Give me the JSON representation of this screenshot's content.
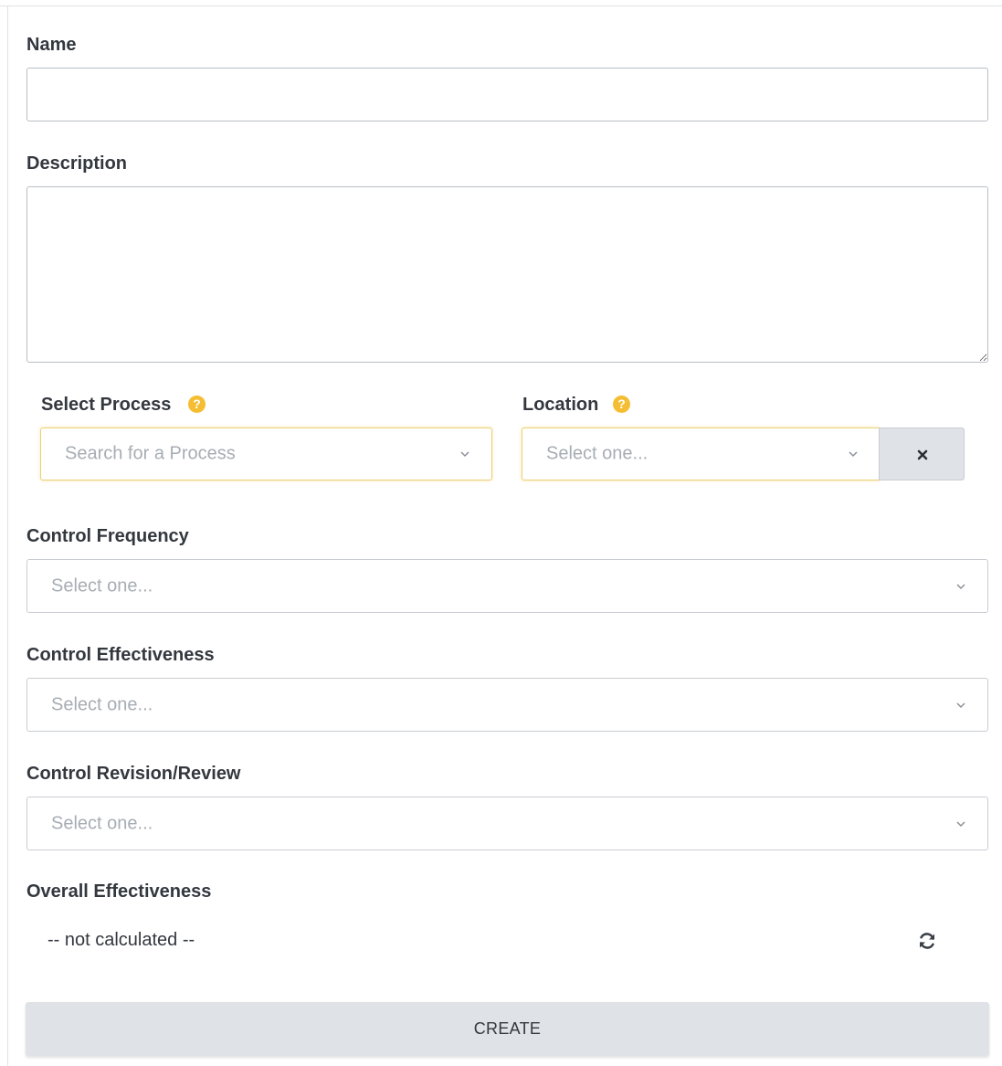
{
  "form": {
    "name": {
      "label": "Name",
      "value": ""
    },
    "description": {
      "label": "Description",
      "value": ""
    },
    "process": {
      "label": "Select Process",
      "help_icon": "question-circle-icon",
      "placeholder": "Search for a Process"
    },
    "location": {
      "label": "Location",
      "help_icon": "question-circle-icon",
      "placeholder": "Select one...",
      "clear_icon": "close-icon"
    },
    "control_frequency": {
      "label": "Control Frequency",
      "placeholder": "Select one..."
    },
    "control_effectiveness": {
      "label": "Control Effectiveness",
      "placeholder": "Select one..."
    },
    "control_revision_review": {
      "label": "Control Revision/Review",
      "placeholder": "Select one..."
    },
    "overall_effectiveness": {
      "label": "Overall Effectiveness",
      "value": "-- not calculated --",
      "refresh_icon": "refresh-icon"
    },
    "create_label": "CREATE"
  },
  "colors": {
    "help_icon": "#f5bd32",
    "highlight_border": "#e9d178",
    "button_bg": "#dfe2e6",
    "placeholder": "#a7adb4",
    "text": "#33383f"
  }
}
